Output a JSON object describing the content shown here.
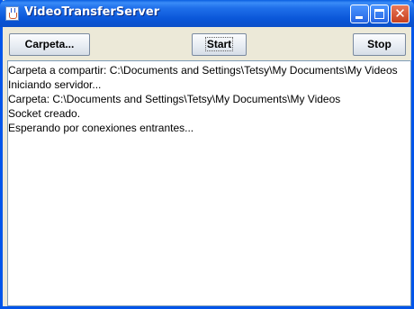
{
  "window": {
    "title": "VideoTransferServer",
    "title_icon": "java-cup-icon",
    "controls": [
      "minimize-icon",
      "maximize-icon",
      "close-icon"
    ],
    "close_glyph": "✕"
  },
  "toolbar": {
    "folder_label": "Carpeta...",
    "start_label": "Start",
    "stop_label": "Stop"
  },
  "log": {
    "lines": [
      "Carpeta a compartir: C:\\Documents and Settings\\Tetsy\\My Documents\\My Videos",
      "Iniciando servidor...",
      "Carpeta: C:\\Documents and Settings\\Tetsy\\My Documents\\My Videos",
      "Socket creado.",
      "Esperando por conexiones entrantes..."
    ]
  },
  "colors": {
    "titlebar": "#0a56d8",
    "close_button": "#c7401e",
    "window_bg": "#ece9d8"
  }
}
